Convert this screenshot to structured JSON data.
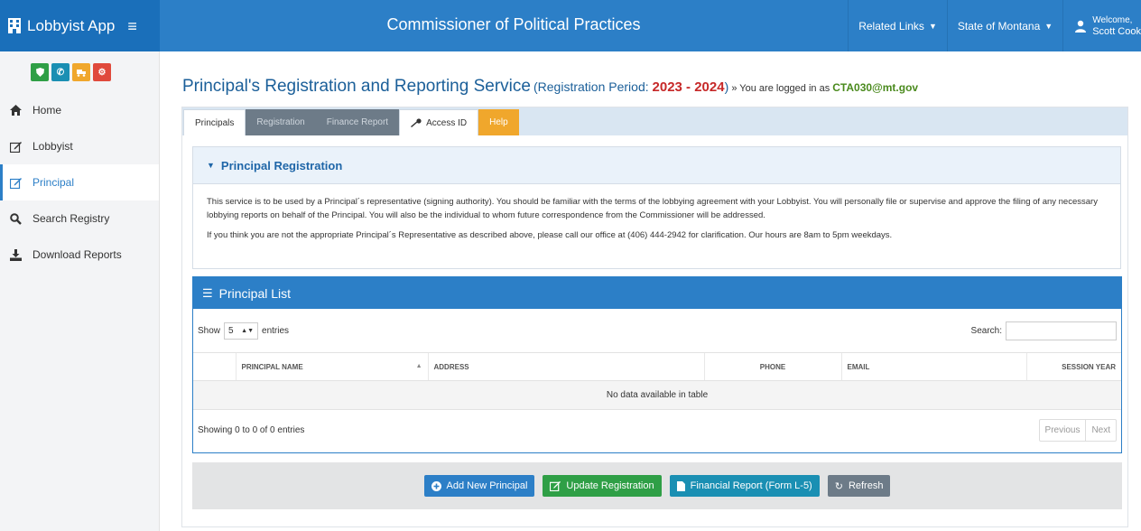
{
  "app": {
    "brand": "Lobbyist App",
    "title": "Commissioner of Political Practices"
  },
  "top_menu": {
    "related_links": "Related Links",
    "state": "State of Montana",
    "welcome": "Welcome,",
    "user": "Scott Cook"
  },
  "sidebar": {
    "quick_buttons": [
      {
        "icon": "shield-icon",
        "color": "#2f9f46"
      },
      {
        "icon": "phone-icon",
        "color": "#1a8fb3"
      },
      {
        "icon": "truck-icon",
        "color": "#f0a72c"
      },
      {
        "icon": "cogs-icon",
        "color": "#e0493b"
      }
    ],
    "items": [
      {
        "label": "Home",
        "icon": "home-icon"
      },
      {
        "label": "Lobbyist",
        "icon": "edit-icon"
      },
      {
        "label": "Principal",
        "icon": "edit-icon",
        "active": true
      },
      {
        "label": "Search Registry",
        "icon": "search-icon"
      },
      {
        "label": "Download Reports",
        "icon": "download-icon"
      }
    ]
  },
  "heading": {
    "title": "Principal's Registration and Reporting Service",
    "period_prefix": "(Registration Period: ",
    "period": "2023 - 2024",
    "period_suffix": ")",
    "logged_prefix": "» You are logged in as",
    "email": "CTA030@mt.gov"
  },
  "tabs": [
    {
      "label": "Principals"
    },
    {
      "label": "Registration"
    },
    {
      "label": "Finance Report"
    },
    {
      "label": "Access ID"
    },
    {
      "label": "Help"
    }
  ],
  "registration": {
    "title": "Principal Registration",
    "para1": "This service is to be used by a Principal´s representative (signing authority). You should be familiar with the terms of the lobbying agreement with your Lobbyist. You will personally file or supervise and approve the filing of any necessary lobbying reports on behalf of the Principal. You will also be the individual to whom future correspondence from the Commissioner will be addressed.",
    "para2": "If you think you are not the appropriate Principal´s Representative as described above, please call our office at (406) 444-2942 for clarification. Our hours are 8am to 5pm weekdays."
  },
  "principal_list": {
    "title": "Principal List",
    "show_label": "Show",
    "entries_value": "5",
    "entries_label": "entries",
    "search_label": "Search:",
    "columns": [
      "",
      "PRINCIPAL NAME",
      "ADDRESS",
      "PHONE",
      "EMAIL",
      "SESSION YEAR"
    ],
    "empty_text": "No data available in table",
    "info": "Showing 0 to 0 of 0 entries",
    "prev": "Previous",
    "next": "Next"
  },
  "actions": {
    "add": "Add New Principal",
    "update": "Update Registration",
    "financial": "Financial Report (Form L-5)",
    "refresh": "Refresh"
  }
}
